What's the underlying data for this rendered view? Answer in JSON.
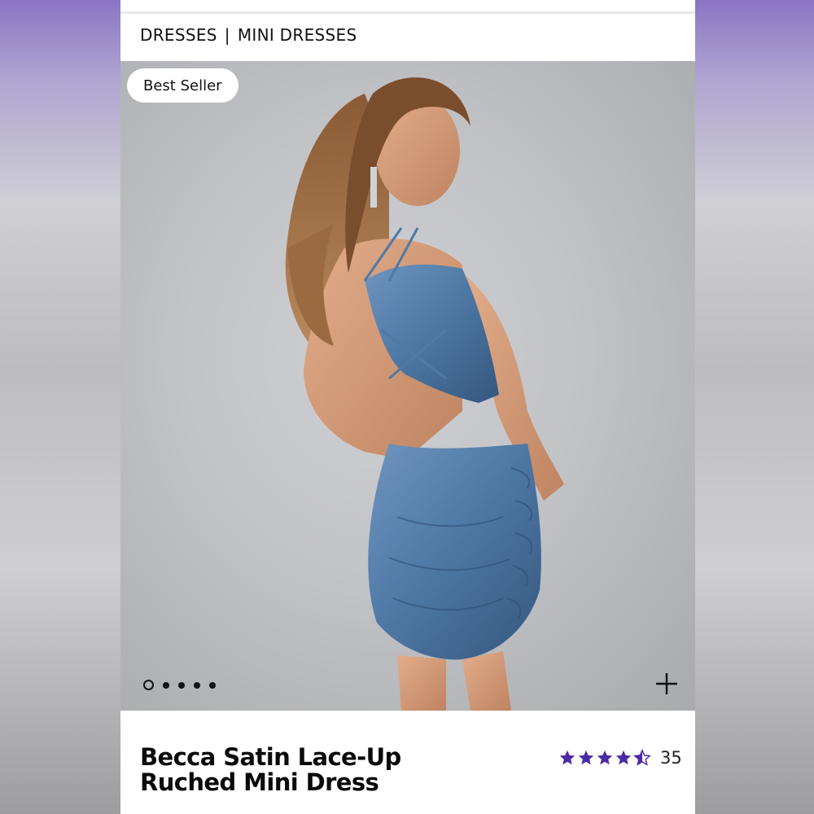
{
  "breadcrumb": {
    "items": [
      "DRESSES",
      "MINI DRESSES"
    ],
    "separator": "|"
  },
  "gallery": {
    "badge": "Best Seller",
    "total_images": 5,
    "active_index": 0,
    "photo_description": "Model with long wavy hair in a blue satin lace-up ruched mini dress, viewed from the back",
    "dress_color": "#4f79a6"
  },
  "product": {
    "title": "Becca Satin Lace-Up Ruched Mini Dress",
    "rating_value": 4.5,
    "rating_max": 5,
    "review_count": "35",
    "star_color": "#4b2aa6"
  }
}
